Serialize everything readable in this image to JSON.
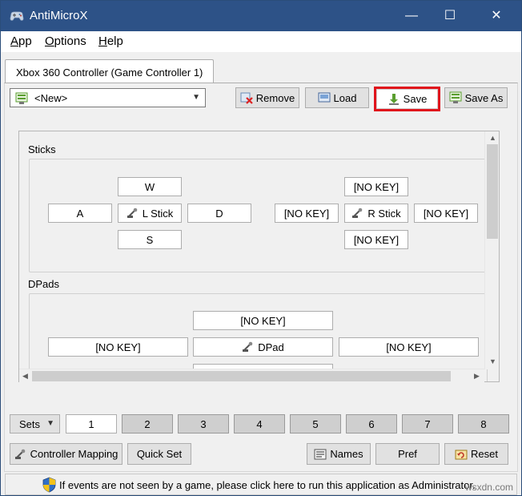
{
  "window": {
    "title": "AntiMicroX",
    "minimize_glyph": "—",
    "maximize_glyph": "☐",
    "close_glyph": "✕"
  },
  "menu": {
    "items": [
      {
        "label": "App",
        "accel": "A",
        "rest": "pp"
      },
      {
        "label": "Options",
        "accel": "O",
        "rest": "ptions"
      },
      {
        "label": "Help",
        "accel": "H",
        "rest": "elp"
      }
    ]
  },
  "tab": {
    "label": "Xbox 360 Controller (Game Controller 1)"
  },
  "profile": {
    "selected": "<New>"
  },
  "toolbar": {
    "remove_label": "Remove",
    "load_label": "Load",
    "save_label": "Save",
    "save_as_label": "Save As"
  },
  "sticks": {
    "title": "Sticks",
    "left": {
      "up": "W",
      "left": "A",
      "center": "L Stick",
      "right": "D",
      "down": "S"
    },
    "right": {
      "up": "[NO KEY]",
      "left": "[NO KEY]",
      "center": "R Stick",
      "right": "[NO KEY]",
      "down": "[NO KEY]"
    }
  },
  "dpads": {
    "title": "DPads",
    "up": "[NO KEY]",
    "left": "[NO KEY]",
    "center": "DPad",
    "right": "[NO KEY]"
  },
  "sets": {
    "label": "Sets",
    "numbers": [
      "1",
      "2",
      "3",
      "4",
      "5",
      "6",
      "7",
      "8"
    ],
    "active": "1"
  },
  "bottom": {
    "controller_mapping_label": "Controller Mapping",
    "quick_set_label": "Quick Set",
    "names_label": "Names",
    "pref_label": "Pref",
    "reset_label": "Reset"
  },
  "status": {
    "message": "If events are not seen by a game, please click here to run this application as Administrator."
  },
  "watermark": "wsxdn.com",
  "colors": {
    "titlebar": "#2d5287",
    "highlight": "#e0141c",
    "accent_green": "#5a9e2f"
  }
}
